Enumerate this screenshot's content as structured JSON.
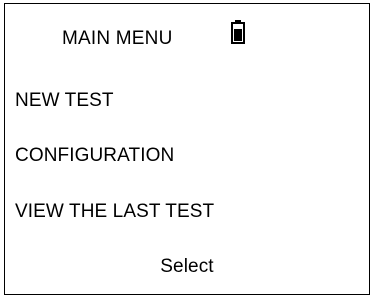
{
  "header": {
    "title": "MAIN MENU",
    "battery_icon": "battery-icon"
  },
  "menu": {
    "items": [
      {
        "label": "NEW TEST"
      },
      {
        "label": "CONFIGURATION"
      },
      {
        "label": "VIEW THE LAST TEST"
      }
    ]
  },
  "softkey": {
    "label": "Select"
  },
  "colors": {
    "foreground": "#000000",
    "background": "#ffffff"
  }
}
